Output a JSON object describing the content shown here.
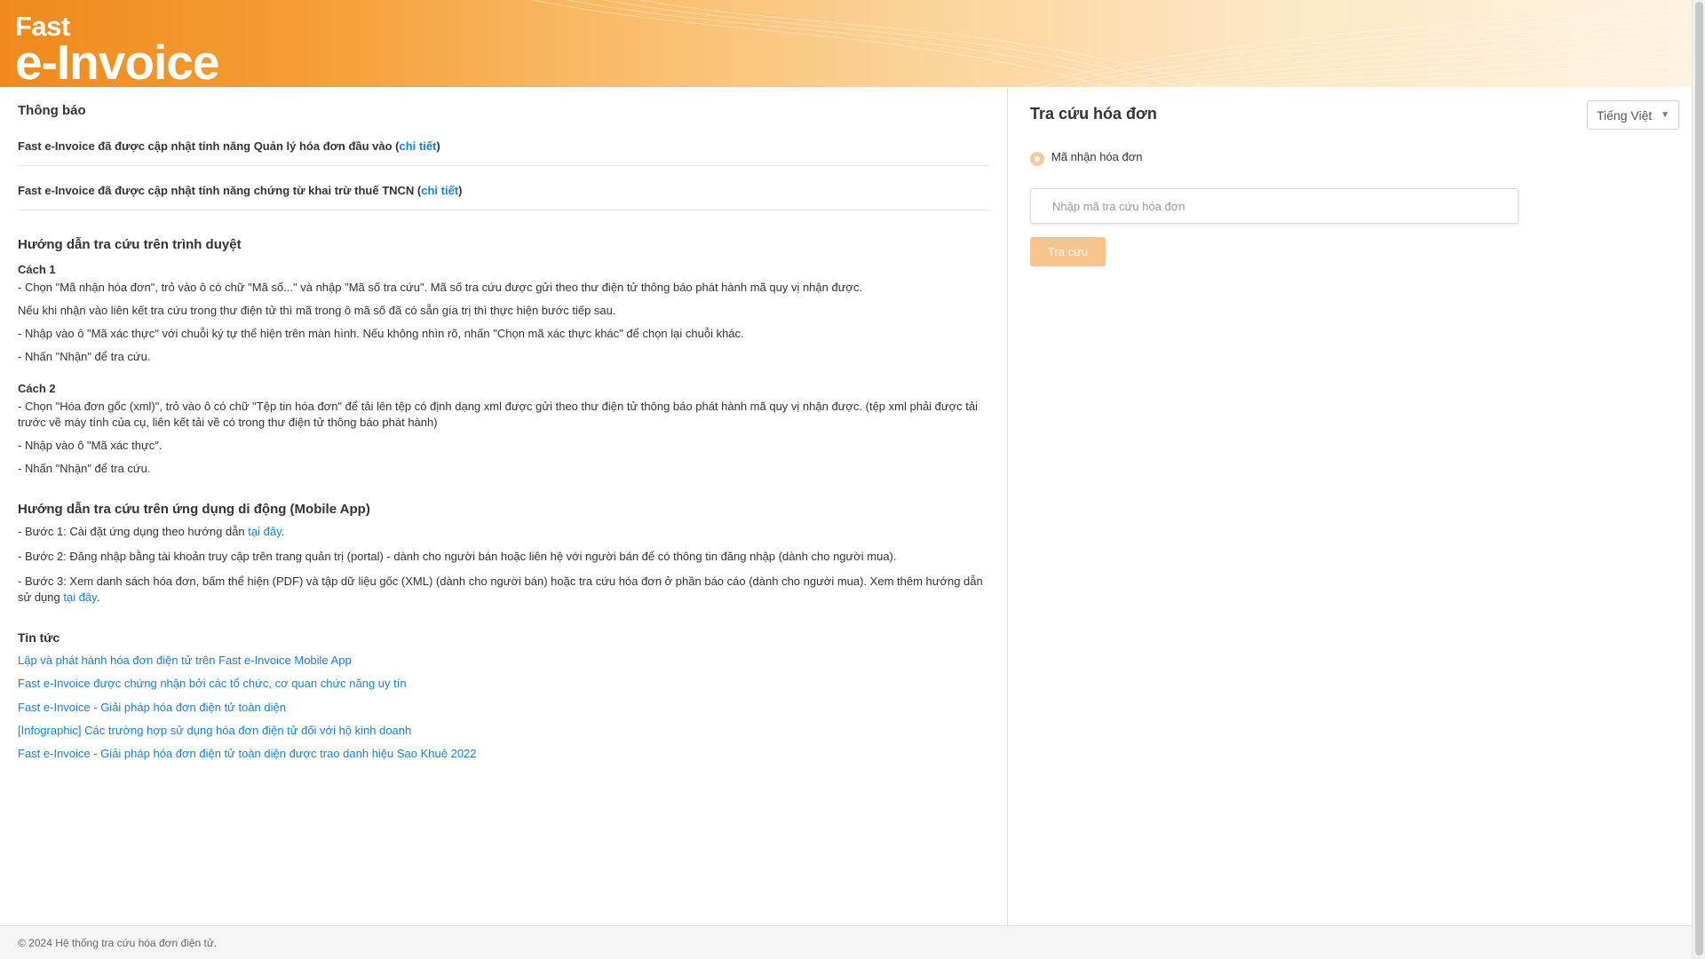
{
  "header": {
    "logo_line1": "Fast",
    "logo_line2": "e-Invoice"
  },
  "notices": {
    "title": "Thông báo",
    "items": [
      {
        "text": "Fast e-Invoice đã được cập nhật tính năng Quản lý hóa đơn đầu vào (",
        "link": "chi tiết",
        "suffix": ")"
      },
      {
        "text": "Fast e-Invoice đã được cập nhật tính năng chứng từ khai trừ thuế TNCN (",
        "link": "chi tiết",
        "suffix": ")"
      }
    ]
  },
  "browser_guide": {
    "title": "Hướng dẫn tra cứu trên trình duyệt",
    "method1": {
      "title": "Cách 1",
      "lines": [
        "- Chọn \"Mã nhận hóa đơn\", trỏ vào ô có chữ \"Mã số...\" và nhập \"Mã số tra cứu\". Mã số tra cứu được gửi theo thư điện tử thông báo phát hành mã quy vị nhận được.",
        "Nếu khi nhận vào liên kết tra cứu trong thư điện tử thì mã trong ô mã số đã có sẵn gía trị thì thực hiện bước tiếp sau.",
        "- Nhập vào ô \"Mã xác thực\" với chuỗi ký tự thể hiện trên màn hình. Nếu không nhìn rõ, nhấn \"Chọn mã xác thực khác\" để chọn lại chuỗi khác.",
        "- Nhấn \"Nhận\" để tra cứu."
      ]
    },
    "method2": {
      "title": "Cách 2",
      "lines": [
        "- Chọn \"Hóa đơn gốc (xml)\", trỏ vào ô có chữ \"Tệp tin hóa đơn\" để tải lên tệp có định dạng xml được gửi theo thư điện tử thông báo phát hành mã quy vị nhận được. (tệp xml phải được tải trước về máy tính của cụ, liên kết tải về có trong thư điện tử thông báo phát hành)",
        "- Nhập vào ô \"Mã xác thực\".",
        "- Nhấn \"Nhận\" để tra cứu."
      ]
    }
  },
  "mobile_guide": {
    "title": "Hướng dẫn tra cứu trên ứng dụng di động (Mobile App)",
    "step1_text": "- Bước 1: Cài đặt ứng dụng theo hướng dẫn ",
    "step1_link": "tại đây",
    "step2_text": "- Bước 2: Đăng nhập bằng tài khoản truy cập trên trang quản trị (portal) - dành cho người bán hoặc liên hệ với người bán để có thông tin đăng nhập (dành cho người mua).",
    "step3_text": "- Bước 3: Xem danh sách hóa đơn, bấm thể hiện (PDF) và tập dữ liệu gốc (XML) (dành cho người bán) hoặc tra cứu hóa đơn ở phần báo cáo (dành cho người mua). Xem thêm hướng dẫn sử dụng ",
    "step3_link": "tại đây",
    "period": "."
  },
  "news": {
    "title": "Tin tức",
    "items": [
      "Lập và phát hành hóa đơn điện tử trên Fast e-Invoice Mobile App",
      "Fast e-Invoice được chứng nhận bởi các tổ chức, cơ quan chức năng uy tín",
      "Fast e-Invoice - Giải pháp hóa đơn điện tử toàn diện",
      "[Infographic] Các trường hợp sử dụng hóa đơn điện tử đối với hộ kinh doanh",
      "Fast e-Invoice - Giải pháp hóa đơn điện tử toàn diện được trao danh hiệu Sao Khuê 2022"
    ]
  },
  "lookup": {
    "title": "Tra cứu hóa đơn",
    "language": "Tiếng Việt",
    "radio_label": "Mã nhận hóa đơn",
    "input_placeholder": "Nhập mã tra cứu hóa đơn",
    "button_label": "Tra cứu"
  },
  "footer": {
    "text": "© 2024 Hệ thống tra cứu hóa đơn điện tử."
  },
  "colors": {
    "header_orange": "#f08a1c",
    "link_blue": "#1a7fd4",
    "button_orange": "#f8c48c"
  }
}
